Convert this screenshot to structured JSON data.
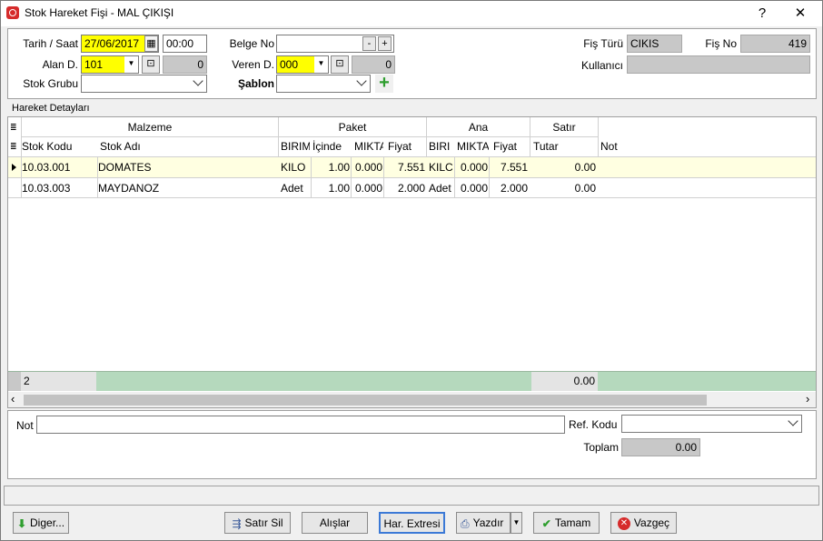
{
  "window": {
    "title": "Stok Hareket Fişi - MAL ÇIKIŞI",
    "help": "?",
    "close": "✕"
  },
  "header": {
    "tarih_label": "Tarih / Saat",
    "tarih_value": "27/06/2017",
    "saat_value": "00:00",
    "alan_label": "Alan D.",
    "alan_value": "101",
    "alan_num": "0",
    "stok_grubu_label": "Stok Grubu",
    "stok_grubu_value": "",
    "belge_label": "Belge No",
    "belge_value": "",
    "belge_minus": "-",
    "belge_plus": "+",
    "veren_label": "Veren D.",
    "veren_value": "000",
    "veren_num": "0",
    "sablon_label": "Şablon",
    "sablon_value": "",
    "fis_turu_label": "Fiş Türü",
    "fis_turu_value": "CIKIS",
    "fis_no_label": "Fiş No",
    "fis_no_value": "419",
    "kullanici_label": "Kullanıcı",
    "kullanici_value": ""
  },
  "grid": {
    "section_label": "Hareket Detayları",
    "groups": {
      "malzeme": "Malzeme",
      "paket": "Paket",
      "ana": "Ana",
      "satir": "Satır"
    },
    "columns": {
      "stok_kodu": "Stok Kodu",
      "stok_adi": "Stok Adı",
      "p_birim": "BIRIM",
      "p_icinde": "İçinde",
      "p_miktar": "MIKTA",
      "p_fiyat": "Fiyat",
      "a_birim": "BIRI",
      "a_miktar": "MIKTA",
      "a_fiyat": "Fiyat",
      "tutar": "Tutar",
      "not": "Not"
    },
    "rows": [
      {
        "stok_kodu": "10.03.001",
        "stok_adi": "DOMATES",
        "p_birim": "KILO",
        "p_icinde": "1.00",
        "p_miktar": "0.000",
        "p_fiyat": "7.551",
        "a_birim": "KILC",
        "a_miktar": "0.000",
        "a_fiyat": "7.551",
        "tutar": "0.00",
        "not": ""
      },
      {
        "stok_kodu": "10.03.003",
        "stok_adi": "MAYDANOZ",
        "p_birim": "Adet",
        "p_icinde": "1.00",
        "p_miktar": "0.000",
        "p_fiyat": "2.000",
        "a_birim": "Adet",
        "a_miktar": "0.000",
        "a_fiyat": "2.000",
        "tutar": "0.00",
        "not": ""
      }
    ],
    "footer_count": "2",
    "footer_total": "0.00"
  },
  "bottom": {
    "not_label": "Not",
    "not_value": "",
    "ref_label": "Ref. Kodu",
    "ref_value": "",
    "toplam_label": "Toplam",
    "toplam_value": "0.00"
  },
  "buttons": {
    "diger": "Diger...",
    "satir_sil": "Satır Sil",
    "alislar": "Alışlar",
    "har_extresi": "Har. Extresi",
    "yazdir": "Yazdır",
    "tamam": "Tamam",
    "vazgec": "Vazgeç"
  },
  "colors": {
    "yellow_field": "#ffff00",
    "selected_row": "#ffffe1",
    "footer_green": "#b5d9bd",
    "gray_field": "#c8c8c8"
  }
}
